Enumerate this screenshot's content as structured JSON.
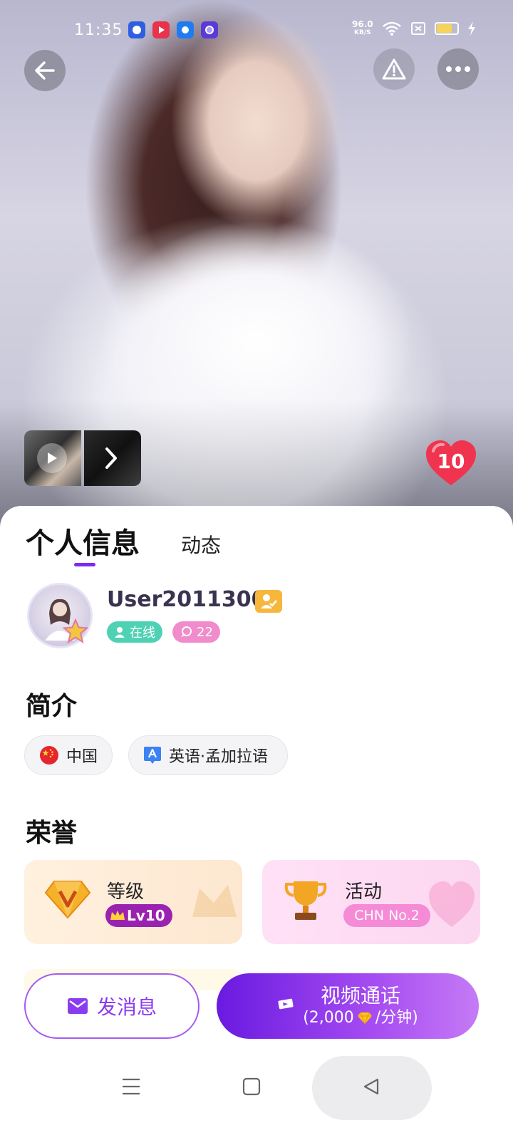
{
  "status_bar": {
    "time": "11:35",
    "net_speed_value": "96.0",
    "net_speed_unit": "KB/S",
    "battery_level": 0.75,
    "app_icons": [
      "baidu-app-icon",
      "video-app-icon",
      "browser-app-icon",
      "quark-app-icon"
    ]
  },
  "hero": {
    "icons": {
      "back": "arrow-left-icon",
      "report": "warning-icon",
      "more": "more-dots-icon"
    },
    "thumbnail_icons": [
      "play-icon",
      "chevron-right-icon"
    ],
    "likes": "10"
  },
  "tabs": [
    {
      "label": "个人信息",
      "active": true
    },
    {
      "label": "动态",
      "active": false
    }
  ],
  "profile": {
    "username": "User20113007",
    "status": "在线",
    "chat_count": "22"
  },
  "intro": {
    "title": "简介",
    "country": "中国",
    "languages": "英语·孟加拉语"
  },
  "honor": {
    "title": "荣誉",
    "level_label": "等级",
    "level_value": "Lv10",
    "activity_label": "活动",
    "activity_value": "CHN No.2"
  },
  "actions": {
    "message_label": "发消息",
    "call_label": "视频通话",
    "call_price_prefix": "(2,000",
    "call_price_suffix": "/分钟)"
  },
  "colors": {
    "accent": "#7b2cf0",
    "online": "#4fd1b5",
    "chat": "#f08ccb",
    "level_tag": "#9b22b0",
    "activity_tag": "#f58ad6"
  }
}
